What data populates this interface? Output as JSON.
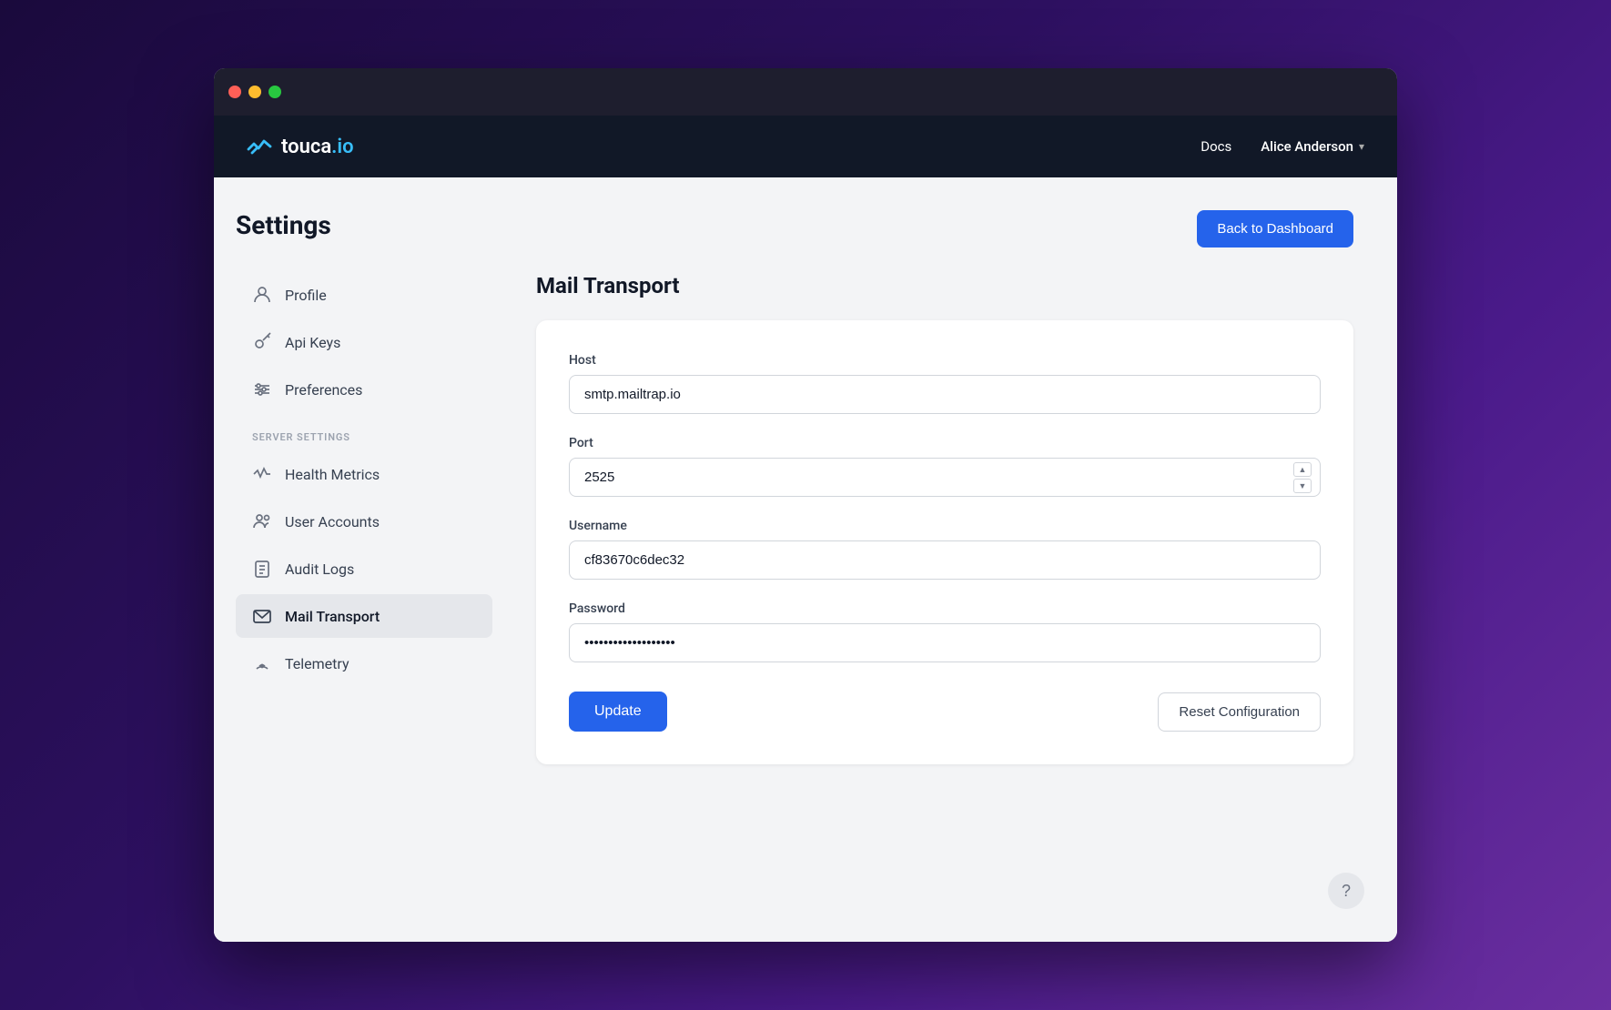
{
  "window": {
    "title": "touca.io Settings"
  },
  "navbar": {
    "logo": "touca",
    "logo_suffix": ".io",
    "docs_label": "Docs",
    "user_name": "Alice Anderson"
  },
  "header": {
    "back_button_label": "Back to Dashboard"
  },
  "sidebar": {
    "page_title": "Settings",
    "items_user": [
      {
        "label": "Profile",
        "icon": "profile-icon",
        "active": false
      },
      {
        "label": "Api Keys",
        "icon": "api-keys-icon",
        "active": false
      },
      {
        "label": "Preferences",
        "icon": "preferences-icon",
        "active": false
      }
    ],
    "server_section_label": "SERVER SETTINGS",
    "items_server": [
      {
        "label": "Health Metrics",
        "icon": "health-icon",
        "active": false
      },
      {
        "label": "User Accounts",
        "icon": "user-accounts-icon",
        "active": false
      },
      {
        "label": "Audit Logs",
        "icon": "audit-icon",
        "active": false
      },
      {
        "label": "Mail Transport",
        "icon": "mail-icon",
        "active": true
      },
      {
        "label": "Telemetry",
        "icon": "telemetry-icon",
        "active": false
      }
    ]
  },
  "form": {
    "section_title": "Mail Transport",
    "host_label": "Host",
    "host_value": "smtp.mailtrap.io",
    "port_label": "Port",
    "port_value": "2525",
    "username_label": "Username",
    "username_value": "cf83670c6dec32",
    "password_label": "Password",
    "password_value": "••••••••••••••",
    "update_label": "Update",
    "reset_label": "Reset Configuration"
  },
  "help": {
    "label": "?"
  }
}
